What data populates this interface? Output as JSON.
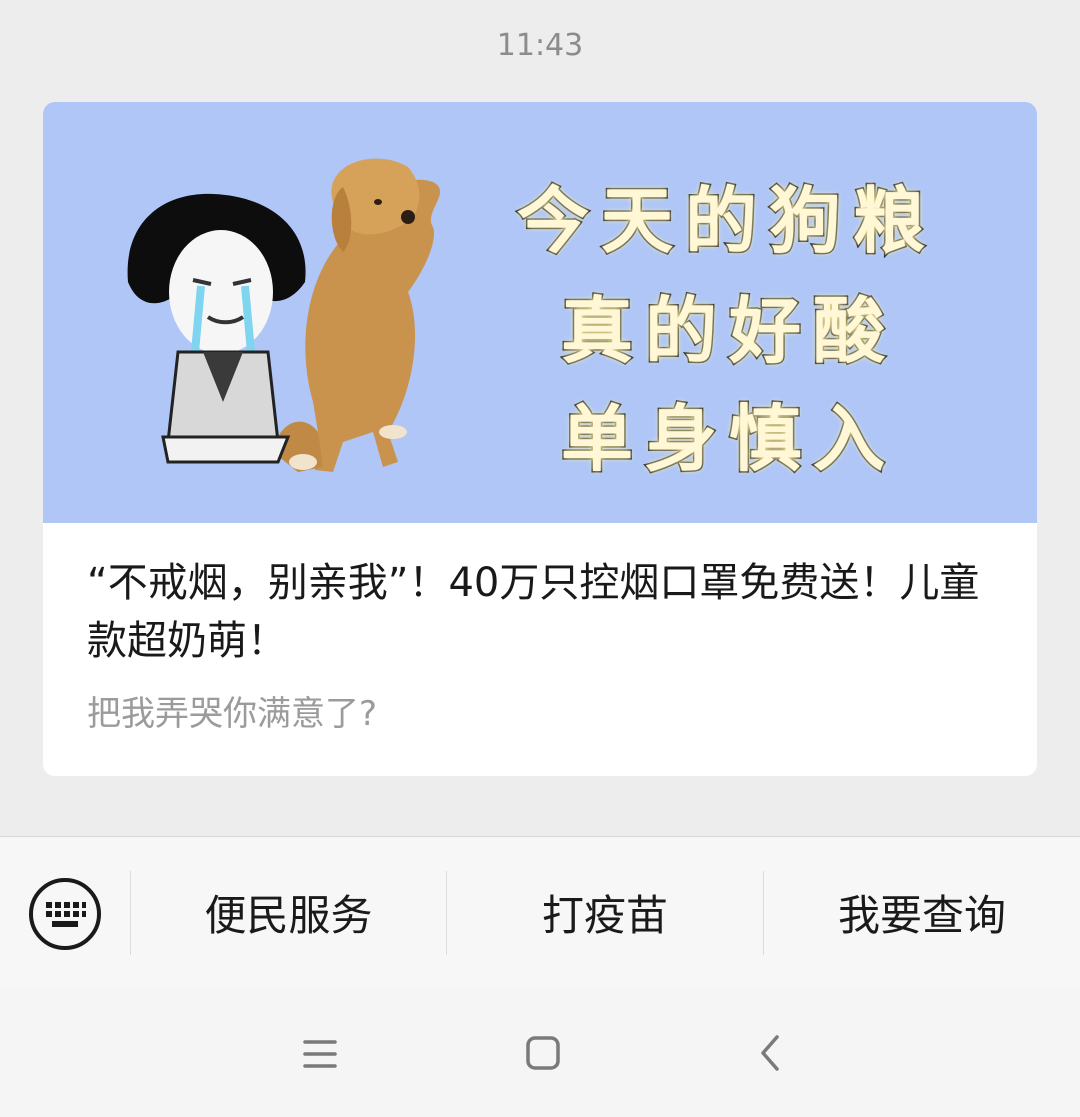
{
  "chat": {
    "timestamp": "11:43"
  },
  "article_card": {
    "cover_text_lines": [
      "今天的狗粮",
      "真的好酸",
      "单身慎入"
    ],
    "title": "“不戒烟，别亲我”！40万只控烟口罩免费送！儿童款超奶萌！",
    "subtitle": "把我弄哭你满意了?",
    "cover_background_color": "#afc6f7"
  },
  "menu_bar": {
    "keyboard_icon": "keyboard-icon",
    "items": [
      {
        "label": "便民服务"
      },
      {
        "label": "打疫苗"
      },
      {
        "label": "我要查询"
      }
    ]
  },
  "system_nav": {
    "icons": [
      "menu-icon",
      "home-icon",
      "back-icon"
    ]
  }
}
